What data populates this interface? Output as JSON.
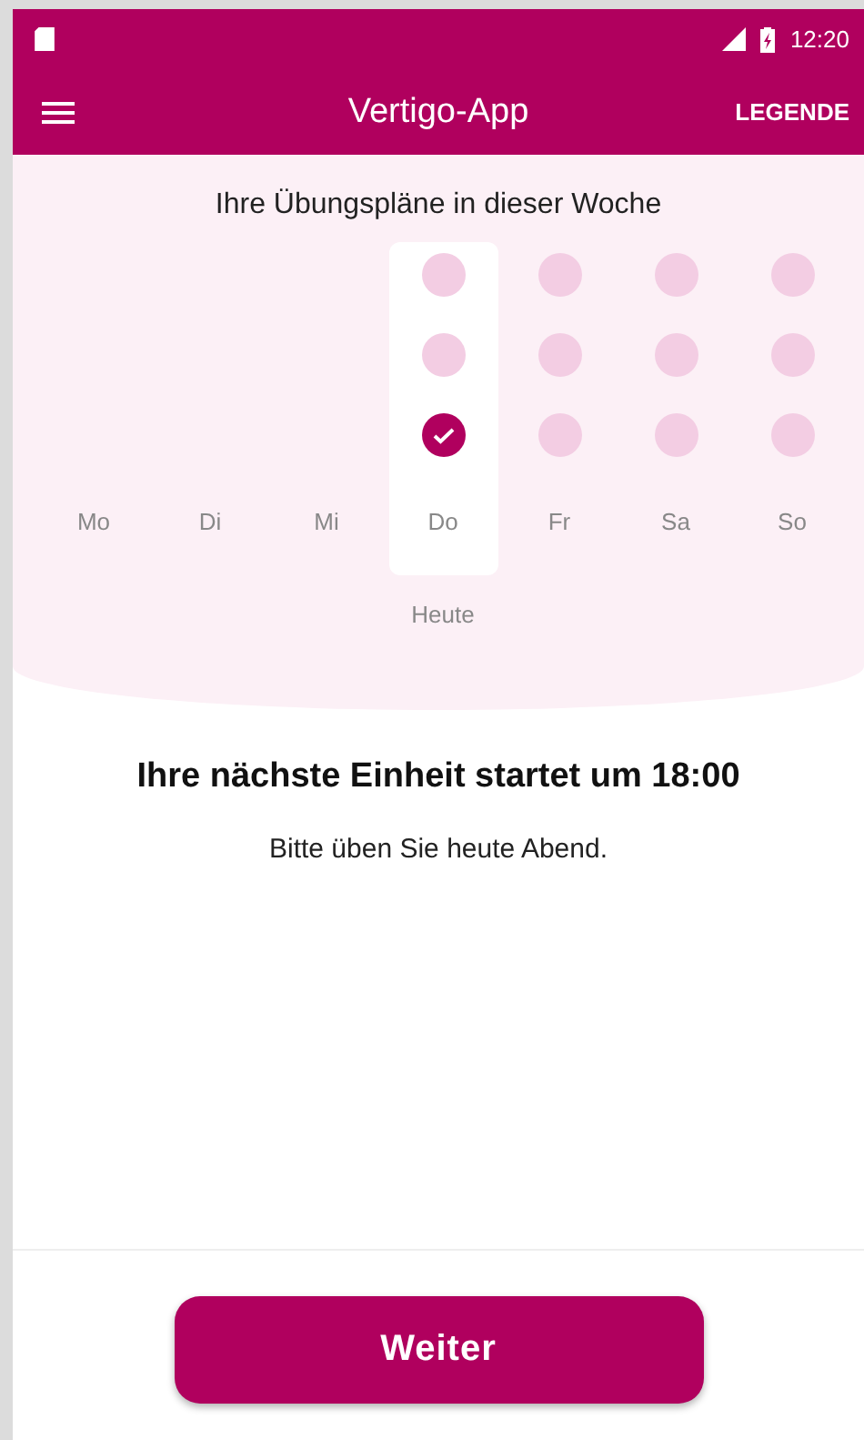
{
  "status_bar": {
    "time": "12:20"
  },
  "app_bar": {
    "title": "Vertigo-App",
    "action": "LEGENDE"
  },
  "week": {
    "title": "Ihre Übungspläne in dieser Woche",
    "today_label": "Heute",
    "days": [
      {
        "label": "Mo",
        "selected": false
      },
      {
        "label": "Di",
        "selected": false
      },
      {
        "label": "Mi",
        "selected": false
      },
      {
        "label": "Do",
        "selected": true,
        "sessions": [
          {
            "done": false
          },
          {
            "done": false
          },
          {
            "done": true
          }
        ]
      },
      {
        "label": "Fr",
        "selected": false,
        "sessions": [
          {
            "done": false
          },
          {
            "done": false
          },
          {
            "done": false
          }
        ]
      },
      {
        "label": "Sa",
        "selected": false,
        "sessions": [
          {
            "done": false
          },
          {
            "done": false
          },
          {
            "done": false
          }
        ]
      },
      {
        "label": "So",
        "selected": false,
        "sessions": [
          {
            "done": false
          },
          {
            "done": false
          },
          {
            "done": false
          }
        ]
      }
    ]
  },
  "next": {
    "heading": "Ihre nächste Einheit startet um 18:00",
    "text": "Bitte üben Sie heute Abend."
  },
  "button": "Weiter"
}
